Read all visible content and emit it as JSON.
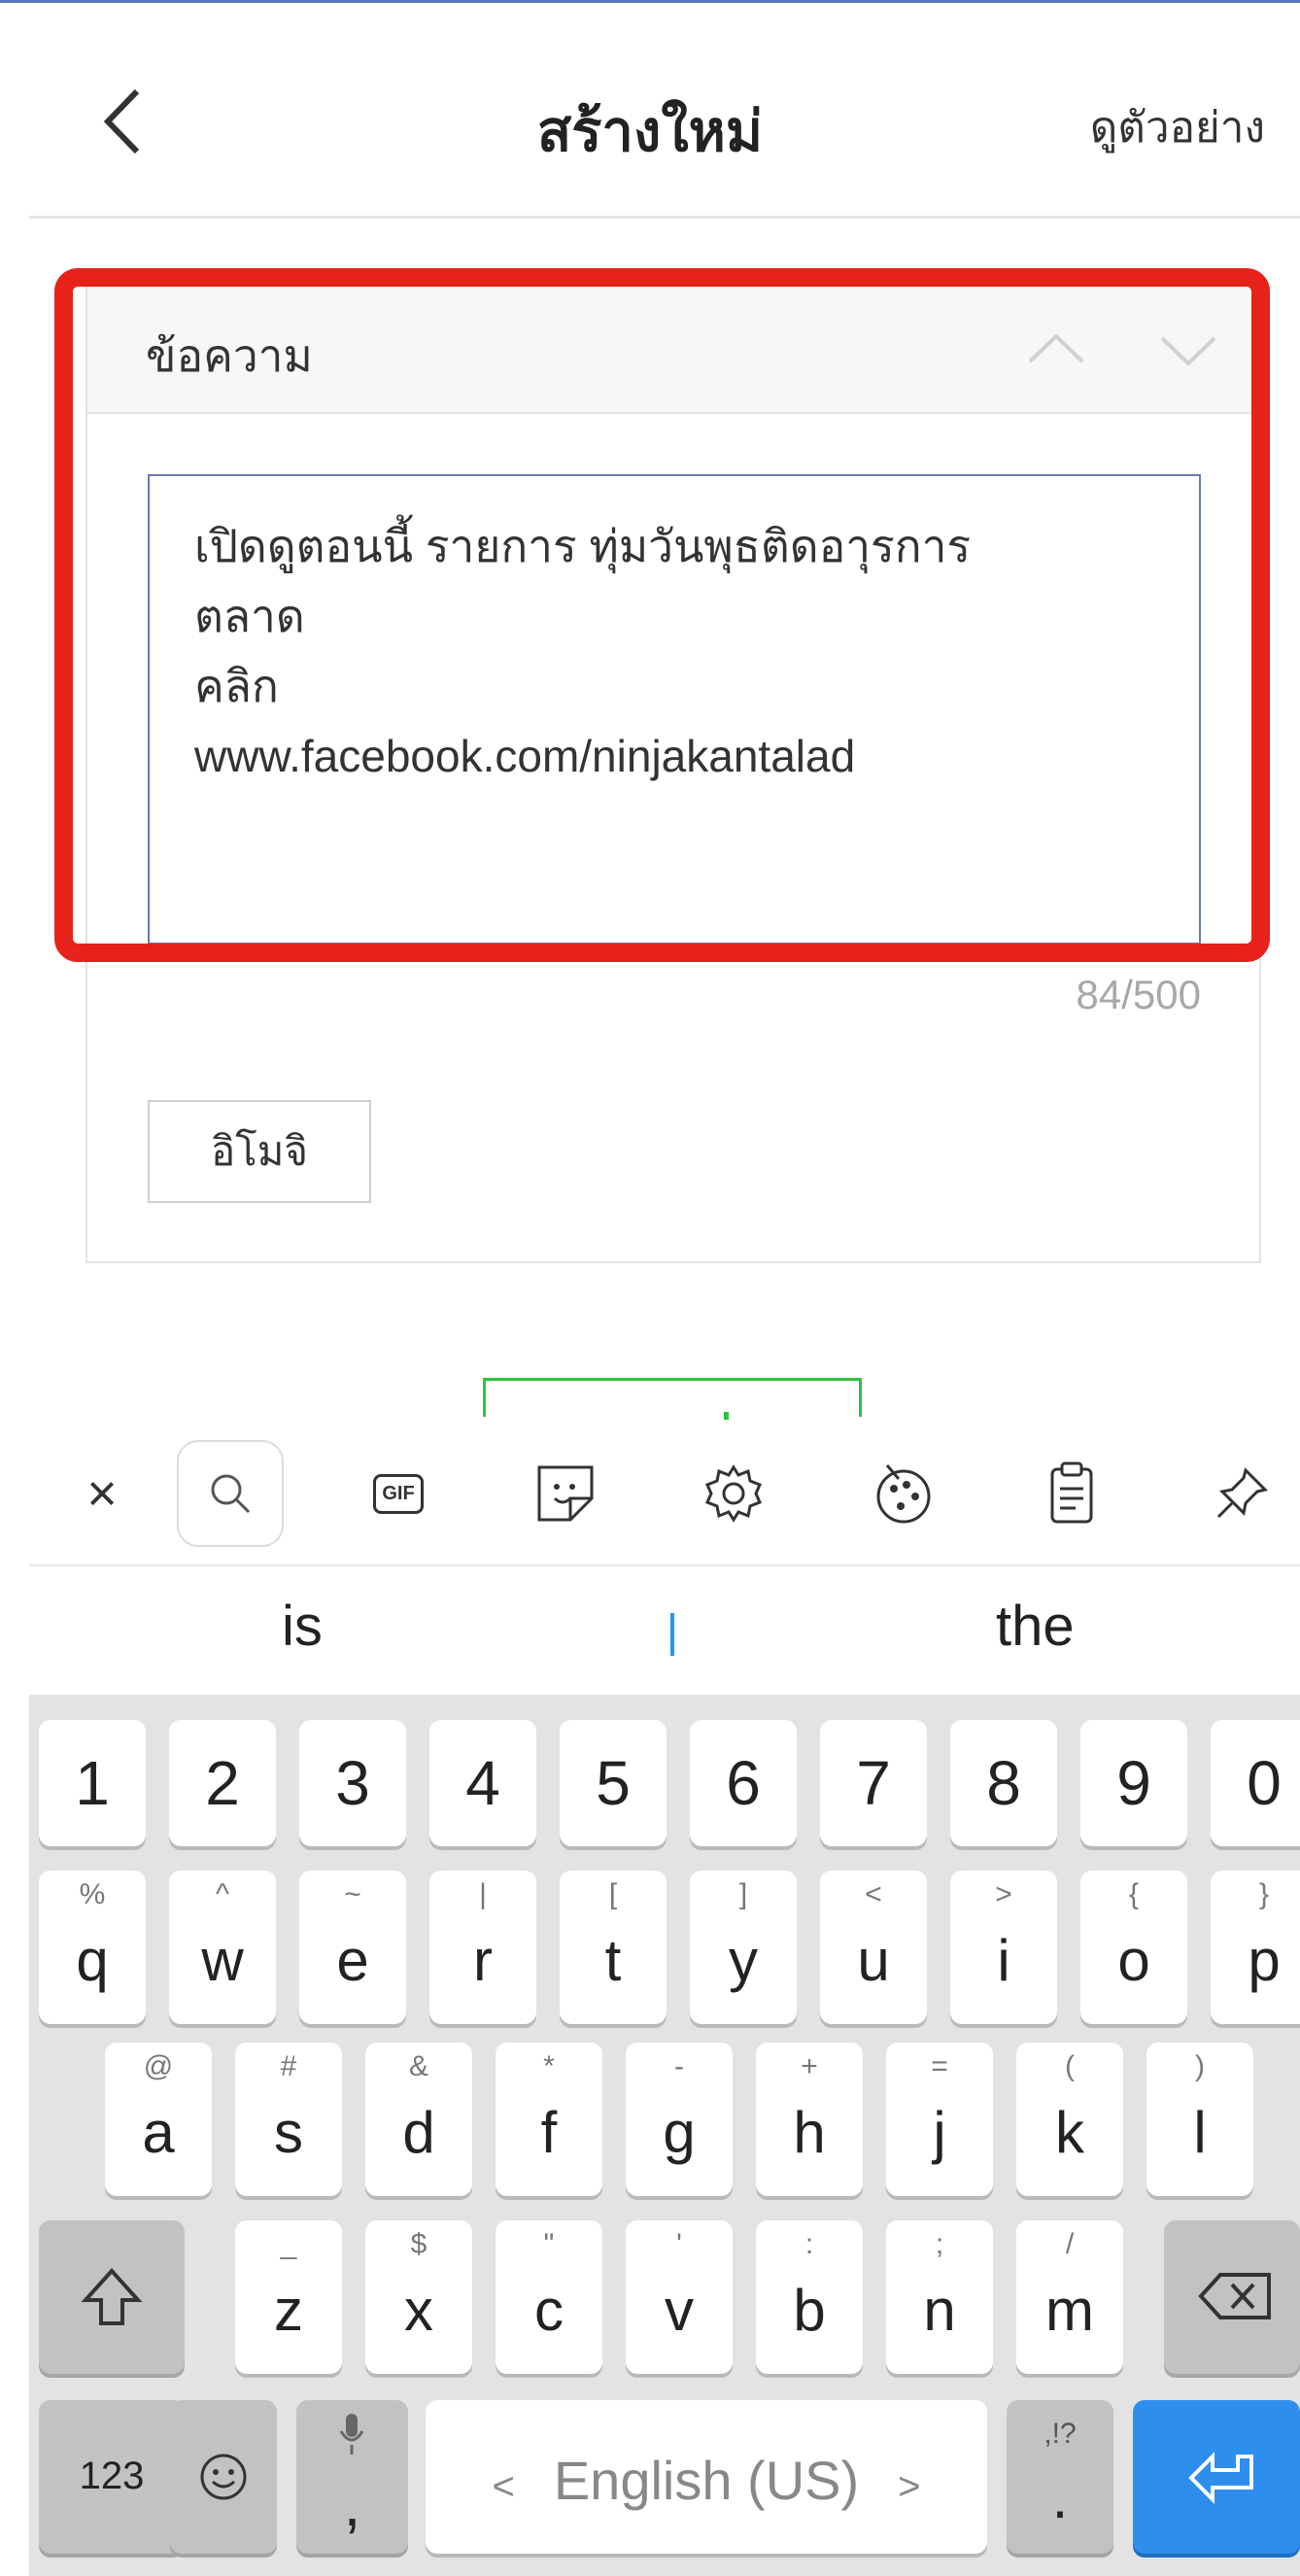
{
  "header": {
    "title": "สร้างใหม่",
    "preview_label": "ดูตัวอย่าง"
  },
  "message_panel": {
    "label": "ข้อความ",
    "text": "เปิดดูตอนนี้ รายการ ทุ่มวันพุธติดอาุรการ\nตลาด\nคลิก\nwww.facebook.com/ninjakantalad",
    "counter": "84/500",
    "emoji_button": "อิโมจิ"
  },
  "keyboard": {
    "toolbar_icons": [
      "close-icon",
      "search-icon",
      "gif-icon",
      "sticker-icon",
      "settings-icon",
      "theme-icon",
      "clipboard-icon",
      "pin-icon"
    ],
    "gif_label": "GIF",
    "close_label": "×",
    "suggestions": [
      "is",
      "the"
    ],
    "number_row": [
      "1",
      "2",
      "3",
      "4",
      "5",
      "6",
      "7",
      "8",
      "9",
      "0"
    ],
    "row1": [
      {
        "k": "q",
        "s": "%"
      },
      {
        "k": "w",
        "s": "^"
      },
      {
        "k": "e",
        "s": "~"
      },
      {
        "k": "r",
        "s": "|"
      },
      {
        "k": "t",
        "s": "["
      },
      {
        "k": "y",
        "s": "]"
      },
      {
        "k": "u",
        "s": "<"
      },
      {
        "k": "i",
        "s": ">"
      },
      {
        "k": "o",
        "s": "{"
      },
      {
        "k": "p",
        "s": "}"
      }
    ],
    "row2": [
      {
        "k": "a",
        "s": "@"
      },
      {
        "k": "s",
        "s": "#"
      },
      {
        "k": "d",
        "s": "&"
      },
      {
        "k": "f",
        "s": "*"
      },
      {
        "k": "g",
        "s": "-"
      },
      {
        "k": "h",
        "s": "+"
      },
      {
        "k": "j",
        "s": "="
      },
      {
        "k": "k",
        "s": "("
      },
      {
        "k": "l",
        "s": ")"
      }
    ],
    "row3": [
      {
        "k": "z",
        "s": "_"
      },
      {
        "k": "x",
        "s": "$"
      },
      {
        "k": "c",
        "s": "\""
      },
      {
        "k": "v",
        "s": "'"
      },
      {
        "k": "b",
        "s": ":"
      },
      {
        "k": "n",
        "s": ";"
      },
      {
        "k": "m",
        "s": "/"
      }
    ],
    "numbers_key": "123",
    "comma_key": ",",
    "space_label": "English (US)",
    "space_left": "<",
    "space_right": ">",
    "period_key": ".",
    "period_sub": ",!?",
    "colors": {
      "accent_red": "#e6221b",
      "enter_blue": "#2e8eee",
      "green": "#2ec23a"
    }
  }
}
